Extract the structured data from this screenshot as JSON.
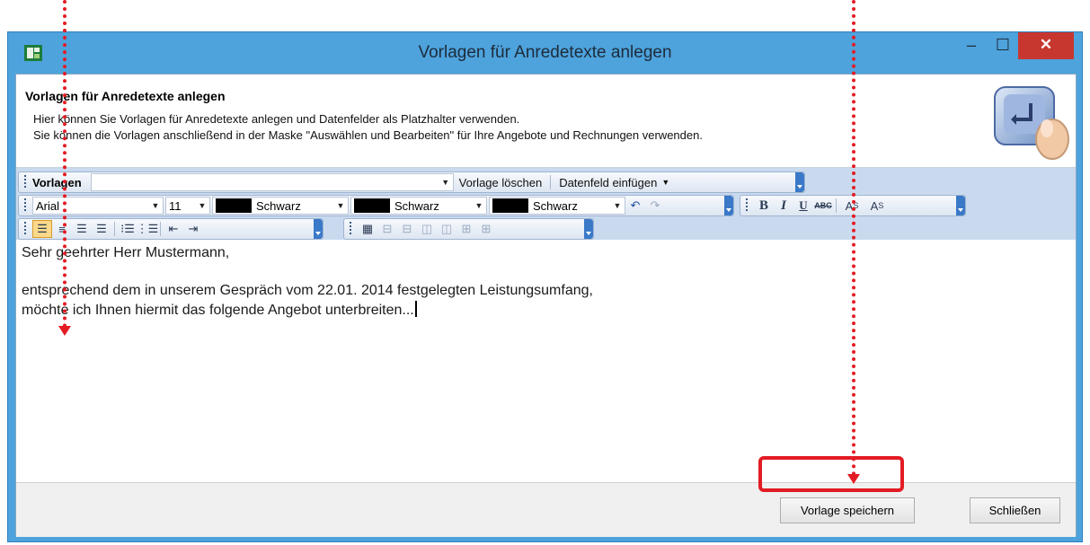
{
  "window": {
    "title": "Vorlagen für Anredetexte anlegen",
    "controls": {
      "minimize": "–",
      "maximize": "☐",
      "close": "✕"
    }
  },
  "header": {
    "title": "Vorlagen für Anredetexte anlegen",
    "line1": "Hier können Sie Vorlagen für Anredetexte anlegen und Datenfelder als Platzhalter verwenden.",
    "line2": "Sie können die Vorlagen anschließend in der Maske \"Auswählen und Bearbeiten\" für Ihre Angebote und Rechnungen verwenden."
  },
  "toolbar1": {
    "label": "Vorlagen",
    "template_value": "",
    "delete_label": "Vorlage löschen",
    "insert_field_label": "Datenfeld einfügen"
  },
  "toolbar2": {
    "font": "Arial",
    "size": "11",
    "color1": "Schwarz",
    "color2": "Schwarz",
    "color3": "Schwarz",
    "bold": "B",
    "italic": "I",
    "underline": "U",
    "strike": "ABC",
    "superscript": "A",
    "superscript_s": "S",
    "subscript": "A",
    "subscript_s": "S"
  },
  "editor": {
    "line1": "Sehr geehrter Herr Mustermann,",
    "line2": "entsprechend dem in unserem Gespräch vom 22.01. 2014 festgelegten Leistungsumfang,",
    "line3": "möchte ich Ihnen hiermit das folgende Angebot unterbreiten..."
  },
  "footer": {
    "save_label": "Vorlage speichern",
    "close_label": "Schließen"
  },
  "colors": {
    "titlebar": "#4ea3dc",
    "toolbar_band": "#c9daef",
    "close_button": "#c7372f",
    "annotation_red": "#e31b23"
  }
}
